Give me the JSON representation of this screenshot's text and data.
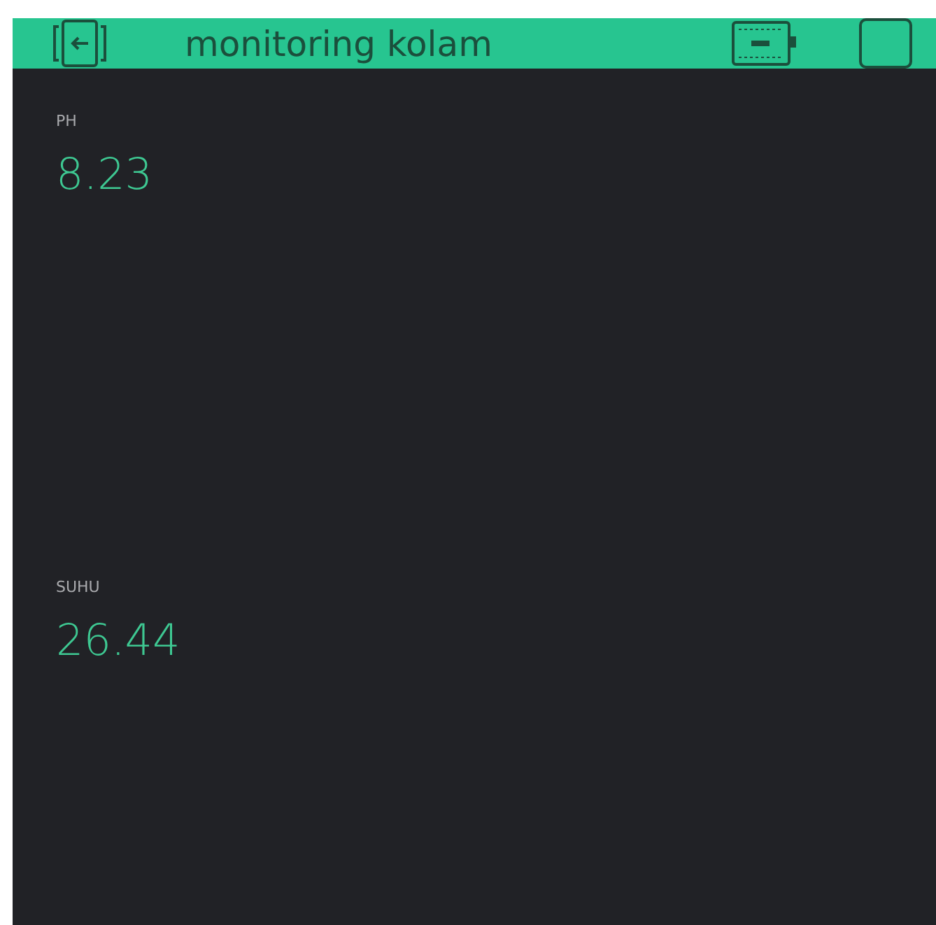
{
  "header": {
    "title": "monitoring kolam"
  },
  "widgets": [
    {
      "label": "PH",
      "value": "8.23"
    },
    {
      "label": "SUHU",
      "value": "26.44"
    }
  ]
}
